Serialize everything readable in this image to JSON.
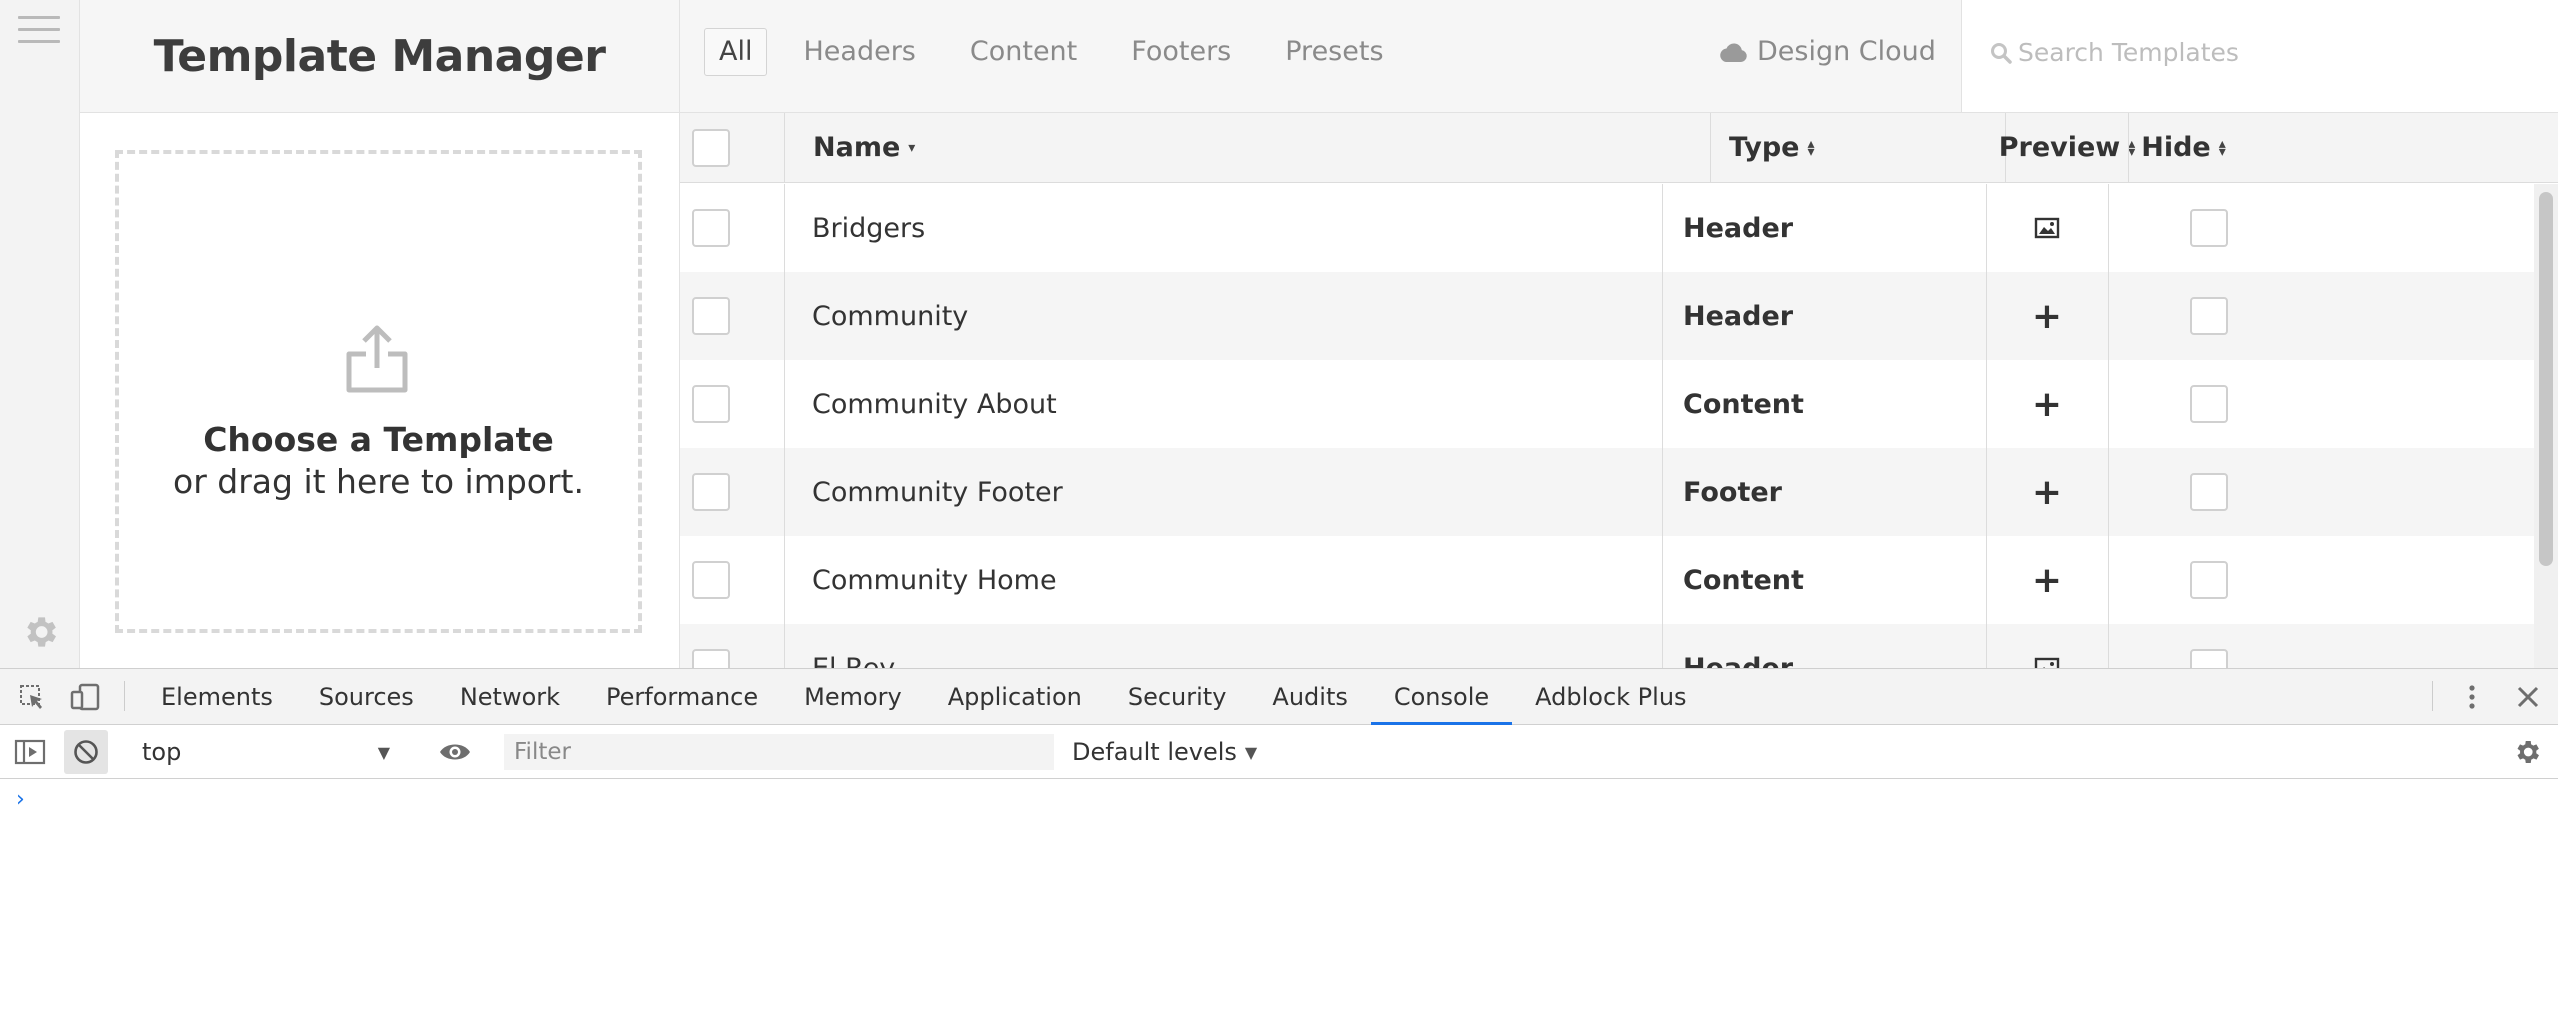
{
  "app": {
    "title": "Template Manager",
    "tabs": [
      "All",
      "Headers",
      "Content",
      "Footers",
      "Presets"
    ],
    "active_tab": "All",
    "cloud_label": "Design Cloud",
    "search_placeholder": "Search Templates",
    "dropzone": {
      "title": "Choose a Template",
      "subtitle": "or drag it here to import."
    },
    "table": {
      "columns": [
        "Name",
        "Type",
        "Preview",
        "Hide"
      ],
      "rows": [
        {
          "name": "Bridgers",
          "type": "Header",
          "preview": "image-icon"
        },
        {
          "name": "Community",
          "type": "Header",
          "preview": "+"
        },
        {
          "name": "Community About",
          "type": "Content",
          "preview": "+"
        },
        {
          "name": "Community Footer",
          "type": "Footer",
          "preview": "+"
        },
        {
          "name": "Community Home",
          "type": "Content",
          "preview": "+"
        },
        {
          "name": "El Rey",
          "type": "Header",
          "preview": "image-icon"
        }
      ]
    }
  },
  "devtools": {
    "tabs": [
      "Elements",
      "Sources",
      "Network",
      "Performance",
      "Memory",
      "Application",
      "Security",
      "Audits",
      "Console",
      "Adblock Plus"
    ],
    "active_tab": "Console",
    "context": "top",
    "filter_placeholder": "Filter",
    "levels": "Default levels",
    "prompt": "›",
    "accent_color": "#1a73e8"
  }
}
